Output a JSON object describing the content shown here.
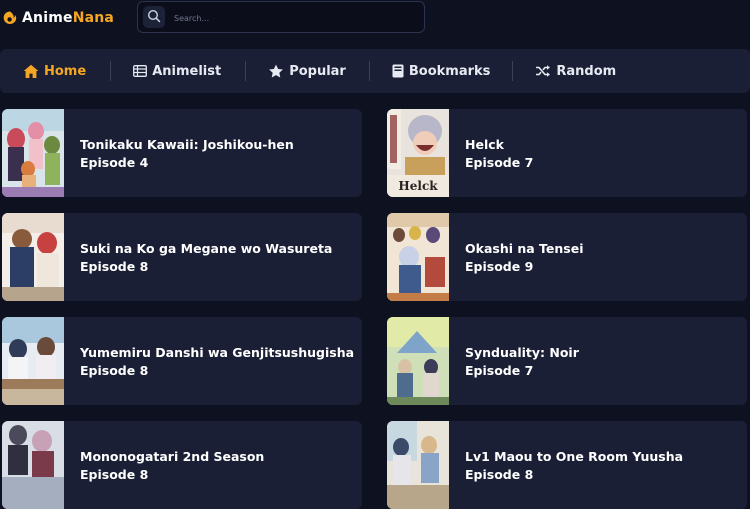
{
  "brand": {
    "name_part1": "Anime",
    "name_part2": "Nana",
    "accent": "#f5a623"
  },
  "search": {
    "placeholder": "Search..."
  },
  "nav": {
    "items": [
      {
        "label": "Home",
        "icon": "home-icon",
        "active": true
      },
      {
        "label": "Animelist",
        "icon": "list-icon"
      },
      {
        "label": "Popular",
        "icon": "star-icon"
      },
      {
        "label": "Bookmarks",
        "icon": "bookmark-icon"
      },
      {
        "label": "Random",
        "icon": "shuffle-icon"
      }
    ]
  },
  "episodes": [
    {
      "title": "Tonikaku Kawaii: Joshikou-hen",
      "episode": "Episode 4"
    },
    {
      "title": "Helck",
      "episode": "Episode 7"
    },
    {
      "title": "Suki na Ko ga Megane wo Wasureta",
      "episode": "Episode 8"
    },
    {
      "title": "Okashi na Tensei",
      "episode": "Episode 9"
    },
    {
      "title": "Yumemiru Danshi wa Genjitsushugisha",
      "episode": "Episode 8"
    },
    {
      "title": "Synduality: Noir",
      "episode": "Episode 7"
    },
    {
      "title": "Mononogatari 2nd Season",
      "episode": "Episode 8"
    },
    {
      "title": "Lv1 Maou to One Room Yuusha",
      "episode": "Episode 8"
    }
  ],
  "thumb_art": {
    "thumb_text": "Helck"
  },
  "colors": {
    "background": "#0e1120",
    "panel": "#1a1f36",
    "accent": "#f5a623"
  }
}
